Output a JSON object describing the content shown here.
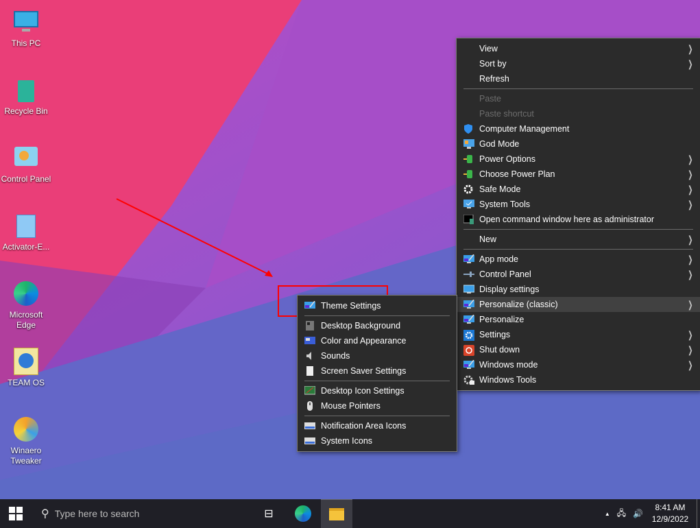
{
  "desktop_icons": [
    {
      "label": "This PC",
      "icon": "computer-icon"
    },
    {
      "label": "Recycle Bin",
      "icon": "recycle-bin-icon"
    },
    {
      "label": "Control Panel",
      "icon": "control-panel-icon"
    },
    {
      "label": "Activator-E...",
      "icon": "folder-icon"
    },
    {
      "label": "Microsoft Edge",
      "icon": "edge-icon"
    },
    {
      "label": "TEAM OS",
      "icon": "globe-icon"
    },
    {
      "label": "Winaero Tweaker",
      "icon": "winaero-icon"
    }
  ],
  "context_menu": {
    "items": [
      {
        "label": "View",
        "submenu": true
      },
      {
        "label": "Sort by",
        "submenu": true
      },
      {
        "label": "Refresh"
      },
      {
        "label": "Paste",
        "disabled": true
      },
      {
        "label": "Paste shortcut",
        "disabled": true
      },
      {
        "label": "Computer Management",
        "icon": "shield-icon"
      },
      {
        "label": "God Mode",
        "icon": "control-panel-icon"
      },
      {
        "label": "Power Options",
        "icon": "battery-icon",
        "submenu": true
      },
      {
        "label": "Choose Power Plan",
        "icon": "battery-icon",
        "submenu": true
      },
      {
        "label": "Safe Mode",
        "icon": "gear-icon",
        "submenu": true
      },
      {
        "label": "System Tools",
        "icon": "monitor-check-icon",
        "submenu": true
      },
      {
        "label": "Open command window here as administrator",
        "icon": "cmd-icon"
      },
      {
        "label": "New",
        "submenu": true
      },
      {
        "label": "App mode",
        "icon": "personalize-icon",
        "submenu": true
      },
      {
        "label": "Control Panel",
        "icon": "control-panel-slider-icon",
        "submenu": true
      },
      {
        "label": "Display settings",
        "icon": "display-icon"
      },
      {
        "label": "Personalize (classic)",
        "icon": "personalize-icon",
        "submenu": true,
        "highlighted": true
      },
      {
        "label": "Personalize",
        "icon": "personalize-icon"
      },
      {
        "label": "Settings",
        "icon": "settings-gear-icon",
        "submenu": true
      },
      {
        "label": "Shut down",
        "icon": "power-icon",
        "submenu": true
      },
      {
        "label": "Windows mode",
        "icon": "personalize-icon",
        "submenu": true
      },
      {
        "label": "Windows Tools",
        "icon": "tools-icon"
      }
    ]
  },
  "submenu": {
    "items": [
      {
        "label": "Theme Settings"
      },
      {
        "label": "Desktop Background"
      },
      {
        "label": "Color and Appearance"
      },
      {
        "label": "Sounds"
      },
      {
        "label": "Screen Saver Settings"
      },
      {
        "label": "Desktop Icon Settings"
      },
      {
        "label": "Mouse Pointers"
      },
      {
        "label": "Notification Area Icons"
      },
      {
        "label": "System Icons"
      }
    ]
  },
  "taskbar": {
    "search_placeholder": "Type here to search",
    "time": "8:41 AM",
    "date": "12/9/2022"
  },
  "colors": {
    "annotation": "#ff0000",
    "menu_bg": "#2b2b2b",
    "highlight": "#414141"
  }
}
